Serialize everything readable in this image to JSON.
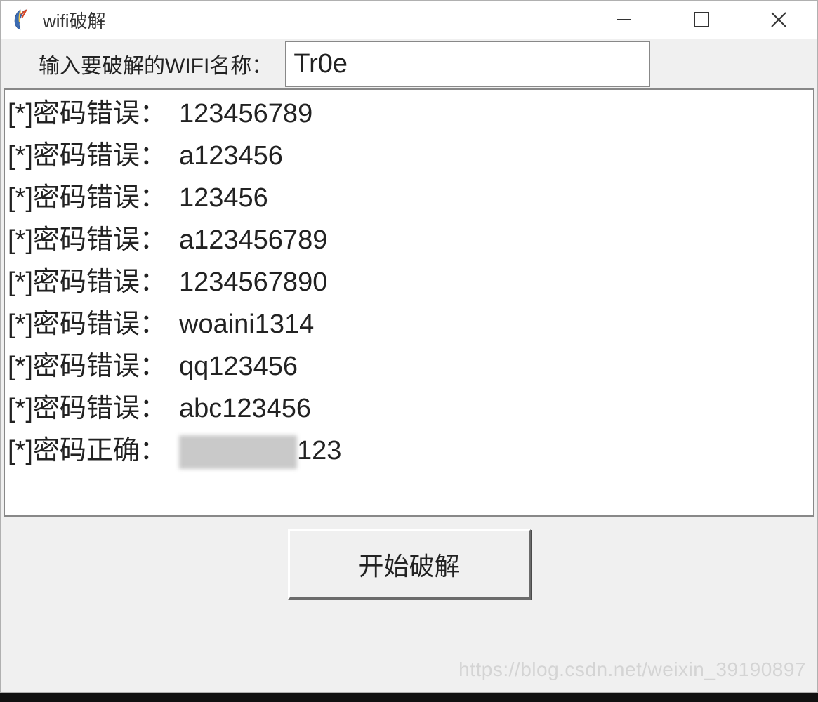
{
  "window": {
    "title": "wifi破解"
  },
  "form": {
    "label": "输入要破解的WIFI名称：",
    "value": "Tr0e"
  },
  "log": {
    "wrong_label": "[*]密码错误：",
    "right_label": "[*]密码正确：",
    "lines": [
      {
        "prefix": "[*]密码错误：",
        "value": "123456789"
      },
      {
        "prefix": "[*]密码错误：",
        "value": "a123456"
      },
      {
        "prefix": "[*]密码错误：",
        "value": "123456"
      },
      {
        "prefix": "[*]密码错误：",
        "value": "a123456789"
      },
      {
        "prefix": "[*]密码错误：",
        "value": "1234567890"
      },
      {
        "prefix": "[*]密码错误：",
        "value": "woaini1314"
      },
      {
        "prefix": "[*]密码错误：",
        "value": "qq123456"
      },
      {
        "prefix": "[*]密码错误：",
        "value": "abc123456"
      }
    ],
    "correct": {
      "prefix": "[*]密码正确：",
      "suffix": "123"
    }
  },
  "button": {
    "start_label": "开始破解"
  },
  "watermark": "https://blog.csdn.net/weixin_39190897"
}
